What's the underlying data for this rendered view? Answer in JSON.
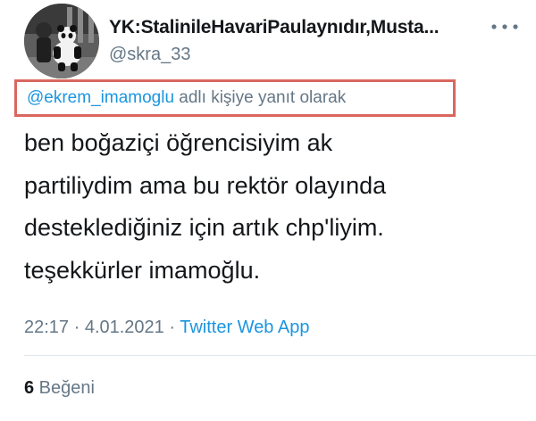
{
  "author": {
    "display_name": "YK:StalinileHavariPaulaynıdır,Musta...",
    "handle": "@skra_33"
  },
  "reply_context": {
    "mention": "@ekrem_imamoglu",
    "suffix": " adlı kişiye yanıt olarak"
  },
  "tweet": {
    "lines": [
      "ben boğaziçi öğrencisiyim ak",
      "partiliydim ama bu rektör olayında",
      "desteklediğiniz için artık chp'liyim.",
      "teşekkürler imamoğlu."
    ]
  },
  "meta": {
    "timestamp": "22:17 · 4.01.2021 · ",
    "source": "Twitter Web App"
  },
  "stats": {
    "likes_count": "6",
    "likes_label": " Beğeni"
  },
  "icons": {
    "more": "more-horizontal-icon"
  },
  "colors": {
    "link": "#1b95e0",
    "secondary_text": "#657786",
    "highlight_box": "#d9675e"
  }
}
